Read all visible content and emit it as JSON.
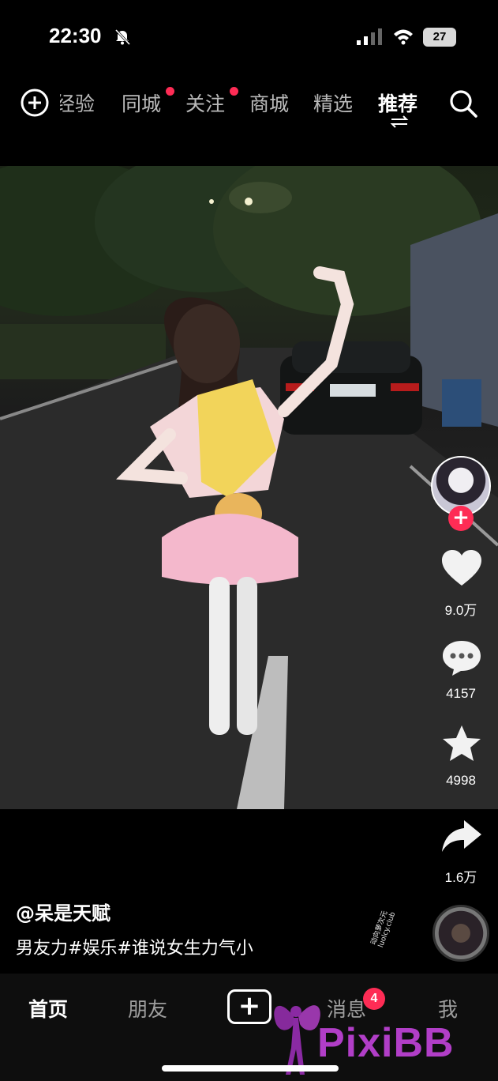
{
  "status_bar": {
    "time": "22:30",
    "battery": "27",
    "icons": [
      "bell-muted-icon",
      "signal-icon",
      "wifi-icon",
      "battery-icon"
    ]
  },
  "top_nav": {
    "tabs": [
      {
        "label": "经验",
        "dot": false
      },
      {
        "label": "同城",
        "dot": true
      },
      {
        "label": "关注",
        "dot": true
      },
      {
        "label": "商城",
        "dot": false
      },
      {
        "label": "精选",
        "dot": false
      },
      {
        "label": "推荐",
        "dot": false,
        "active": true
      }
    ],
    "icons": [
      "add-circle-icon",
      "search-icon",
      "swap-icon"
    ]
  },
  "actions": {
    "likes": "9.0万",
    "comments": "4157",
    "favorites": "4998",
    "shares": "1.6万"
  },
  "caption": {
    "author": "@呆是天赋",
    "text": "男友力#娱乐#谁说女生力气小"
  },
  "music": {
    "stamp_line1": "动向萝次元",
    "stamp_line2": "luolcy.club"
  },
  "bottom_nav": {
    "tabs": [
      "首页",
      "朋友",
      "消息",
      "我"
    ],
    "create_label": "+",
    "messages_badge": "4"
  },
  "watermark": {
    "text": "PixiBB"
  },
  "colors": {
    "accent": "#fe2c55",
    "background": "#000000",
    "watermark": "#b13ec7"
  }
}
